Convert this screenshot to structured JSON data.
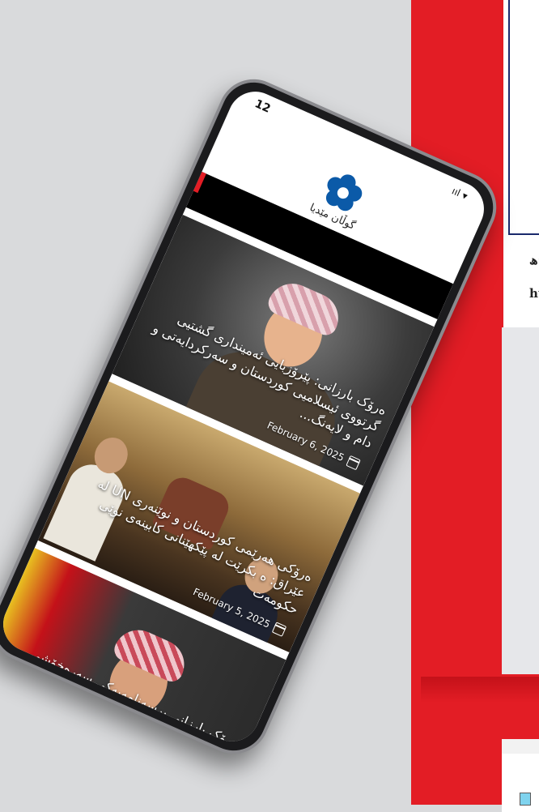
{
  "status_bar": {
    "time": "12",
    "icons": "ııl ▾"
  },
  "app": {
    "logo_text": "گوڵان مێدیا",
    "logo_color": "#0b5aa8"
  },
  "doc": {
    "line1": "ھ:",
    "line2": "ht"
  },
  "articles": [
    {
      "title": "ەرۆک بارزانی: پێرۆزبایی ئەمینداری گشتیی گرتووی ئیسلامیی کوردستان و سەرکردایەتی و دام و لایەنگ...",
      "date": "February 6, 2025"
    },
    {
      "title": "ەرۆکی هەرێمی کوردستان و نوێنەری UN لە عێراق: ە بکرێت لە پێکهێنانی کابینەی نوێی حکومەت",
      "date": "February 5, 2025"
    },
    {
      "title": "ەرۆک بارزانی برسەنامەیەکی سەرەخۆشی ئاراستە واده و کەسوکاری دکتۆر دەشتی دزەیی کرد",
      "date": ""
    }
  ]
}
